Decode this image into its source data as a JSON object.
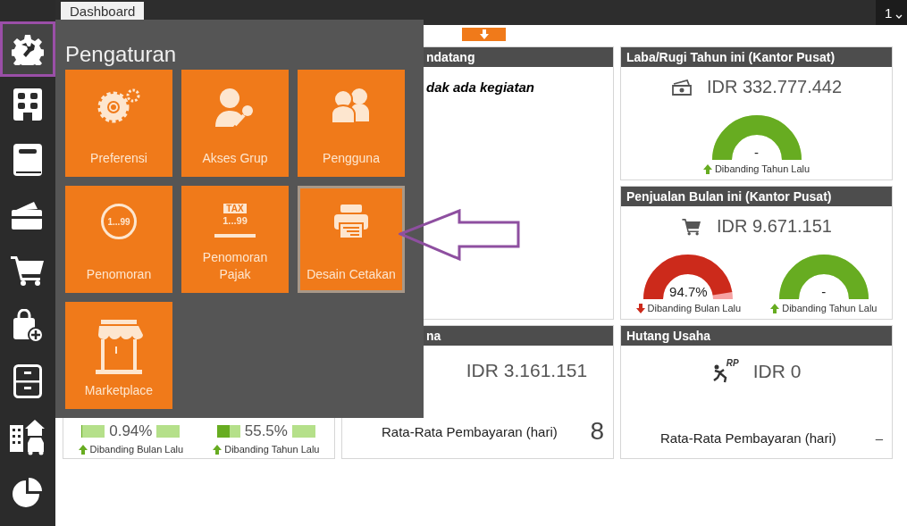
{
  "topbar": {
    "tab": {
      "label": "Dashboard",
      "selected": true
    },
    "page_indicator": "1"
  },
  "sidebar": {
    "items": [
      {
        "kind": "settings",
        "selected": true
      },
      {
        "kind": "building",
        "selected": false
      },
      {
        "kind": "book",
        "selected": false
      },
      {
        "kind": "wallet",
        "selected": false
      },
      {
        "kind": "cart",
        "selected": false
      },
      {
        "kind": "bag",
        "selected": false
      },
      {
        "kind": "cabinet",
        "selected": false
      },
      {
        "kind": "assets",
        "selected": false
      },
      {
        "kind": "chart",
        "selected": false
      }
    ]
  },
  "menu": {
    "title": "Pengaturan",
    "tiles": [
      {
        "label": "Preferensi",
        "kind": "gears",
        "selected": false
      },
      {
        "label": "Akses Grup",
        "kind": "user-key",
        "selected": false
      },
      {
        "label": "Pengguna",
        "kind": "users",
        "selected": false
      },
      {
        "label": "Penomoran",
        "kind": "numbering",
        "icon_texts": [
          "1...99"
        ],
        "selected": false
      },
      {
        "label": "Penomoran Pajak",
        "kind": "tax",
        "icon_texts": [
          "TAX",
          "1...99"
        ],
        "selected": false
      },
      {
        "label": "Desain Cetakan",
        "kind": "printer",
        "selected": true
      },
      {
        "label": "Marketplace",
        "kind": "store",
        "selected": false
      }
    ]
  },
  "dashboard": {
    "left_card": {
      "gauges": [
        {
          "value": "0.94%",
          "level": 0.0094,
          "rising": true,
          "caption": "Dibanding Bulan Lalu"
        },
        {
          "value": "55.5%",
          "level": 0.555,
          "rising": true,
          "caption": "Dibanding Tahun Lalu"
        }
      ]
    },
    "agenda_card": {
      "title": "ndatang",
      "message": "dak ada kegiatan"
    },
    "profit_card": {
      "title": "Laba/Rugi Tahun ini (Kantor Pusat)",
      "amount": "IDR 332.777.442",
      "gauges": [
        {
          "value": "-",
          "level": 1,
          "rising": true,
          "caption": "Dibanding Tahun Lalu"
        }
      ]
    },
    "sales_card": {
      "title": "Penjualan Bulan ini (Kantor Pusat)",
      "amount": "IDR 9.671.151",
      "gauges": [
        {
          "value": "94.7%",
          "level": 0.947,
          "rising": false,
          "caption": "Dibanding Bulan Lalu"
        },
        {
          "value": "-",
          "level": 1,
          "rising": true,
          "caption": "Dibanding Tahun Lalu"
        }
      ]
    },
    "receivable_card": {
      "title": "na",
      "amount": "IDR 3.161.151",
      "metric_label": "Rata-Rata Pembayaran (hari)",
      "metric_value": "8"
    },
    "payable_card": {
      "title": "Hutang Usaha",
      "icon_text": "RP",
      "amount": "IDR 0",
      "metric_label": "Rata-Rata Pembayaran (hari)",
      "metric_value": "–"
    }
  }
}
